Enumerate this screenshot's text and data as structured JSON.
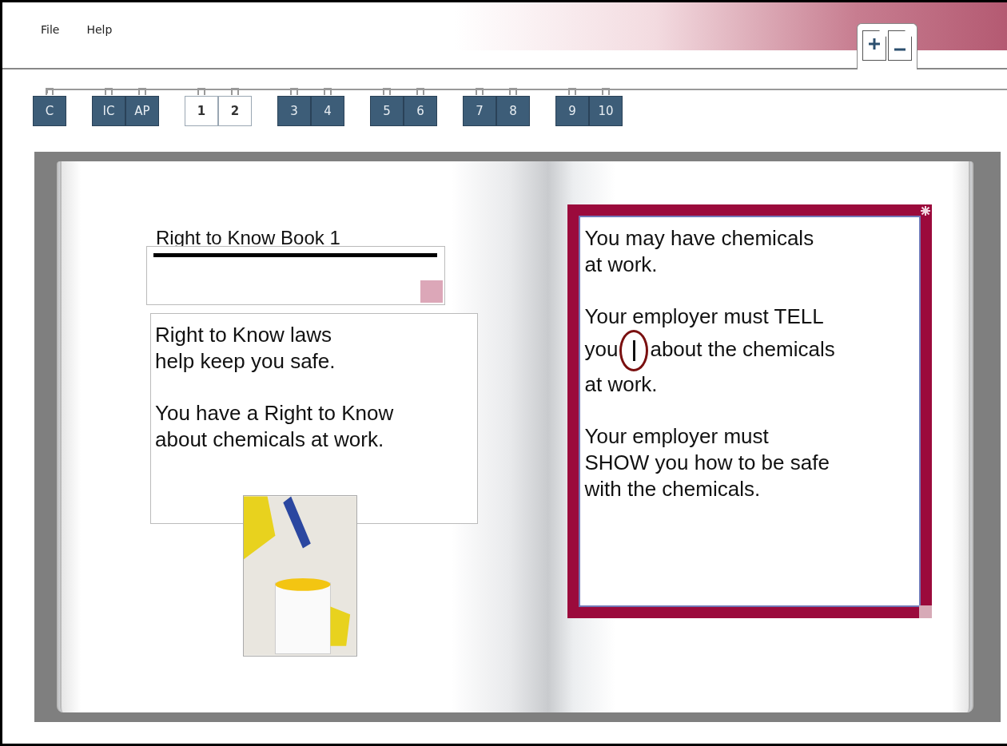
{
  "menu": [
    "File",
    "Help"
  ],
  "page_buttons": [
    {
      "kind": "add"
    },
    {
      "kind": "remove"
    }
  ],
  "tab_groups": [
    {
      "selected": false,
      "tabs": [
        "C"
      ]
    },
    {
      "selected": false,
      "tabs": [
        "IC",
        "AP"
      ]
    },
    {
      "selected": true,
      "tabs": [
        "1",
        "2"
      ]
    },
    {
      "selected": false,
      "tabs": [
        "3",
        "4"
      ]
    },
    {
      "selected": false,
      "tabs": [
        "5",
        "6"
      ]
    },
    {
      "selected": false,
      "tabs": [
        "7",
        "8"
      ]
    },
    {
      "selected": false,
      "tabs": [
        "9",
        "10"
      ]
    }
  ],
  "left_page": {
    "title": "Right to Know Book 1",
    "paragraphs": [
      [
        "Right to Know laws",
        "help keep you safe."
      ],
      [
        "You have a Right to Know",
        "about chemicals at work."
      ]
    ]
  },
  "right_page": {
    "paragraphs": [
      [
        {
          "text": "You may have chemicals"
        },
        {
          "text": "at work."
        }
      ],
      [
        {
          "text": "Your employer must TELL"
        },
        {
          "text": "you",
          "cursor": true,
          "after": "about the chemicals"
        },
        {
          "text": "at work."
        }
      ],
      [
        {
          "text": "Your employer must"
        },
        {
          "text": "SHOW you how to be safe"
        },
        {
          "text": "with the chemicals."
        }
      ]
    ]
  }
}
